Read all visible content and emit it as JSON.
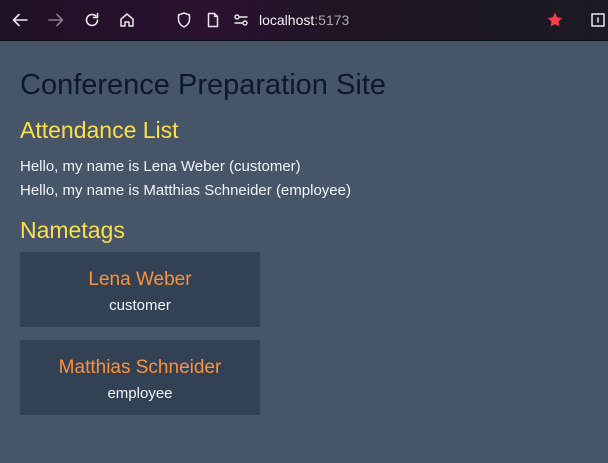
{
  "browser": {
    "url_host": "localhost",
    "url_port": ":5173",
    "colors": {
      "star": "#ff3b4e",
      "toolbar": "#24122a"
    },
    "icons": [
      "back-arrow-icon",
      "forward-arrow-icon",
      "reload-icon",
      "home-icon",
      "shield-icon",
      "page-icon",
      "connection-settings-icon",
      "bookmark-star-icon",
      "account-icon"
    ]
  },
  "page": {
    "title": "Conference Preparation Site",
    "attendance": {
      "heading": "Attendance List",
      "lines": [
        "Hello, my name is Lena Weber (customer)",
        "Hello, my name is Matthias Schneider (employee)"
      ]
    },
    "nametags": {
      "heading": "Nametags",
      "items": [
        {
          "name": "Lena Weber",
          "role": "customer"
        },
        {
          "name": "Matthias Schneider",
          "role": "employee"
        }
      ]
    },
    "colors": {
      "background": "#475569",
      "card": "#334155",
      "heading_accent": "#fde047",
      "name_accent": "#fb923c"
    }
  }
}
